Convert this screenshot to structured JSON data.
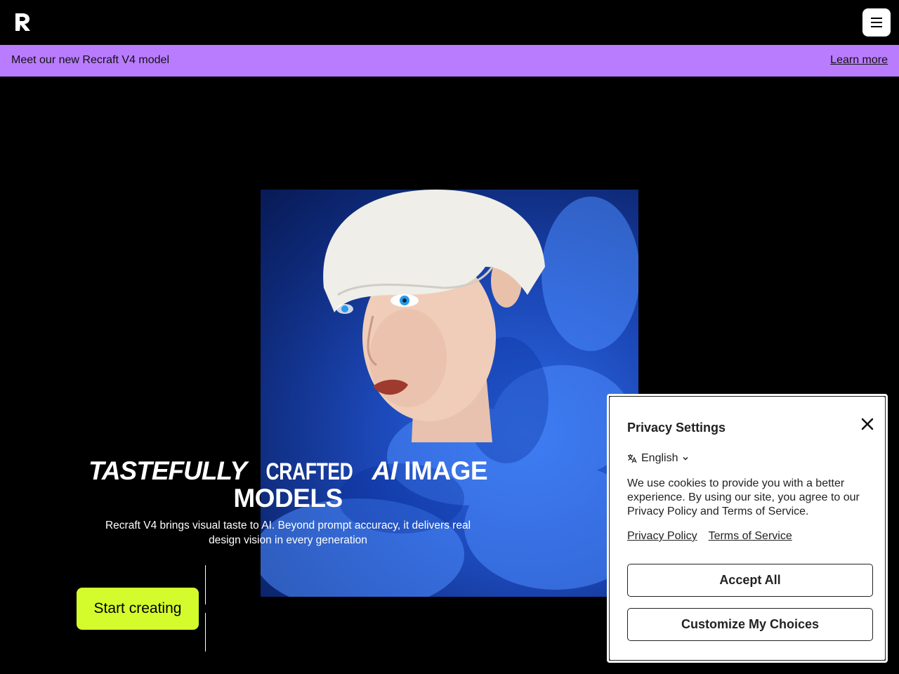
{
  "header": {
    "logo_icon": "recraft-logo-icon",
    "menu_icon": "hamburger-menu-icon"
  },
  "banner": {
    "text": "Meet our new Recraft V4 model",
    "link": "Learn more",
    "color": "#b97cff"
  },
  "hero": {
    "headline_word1": "TASTEFULLY",
    "headline_word2": "CRAFTED",
    "headline_word3": "AI",
    "headline_word4": "IMAGE",
    "headline_word5": "MODELS",
    "subheadline": "Recraft V4 brings visual taste to AI. Beyond prompt accuracy, it delivers real design vision in every generation",
    "cta": "Start creating",
    "cta_color": "#d4fc2c"
  },
  "privacy": {
    "title": "Privacy Settings",
    "language": "English",
    "body": "We use cookies to provide you with a better experience. By using our site, you agree to our Privacy Policy and Terms of Service.",
    "link_privacy": "Privacy Policy",
    "link_terms": "Terms of Service",
    "accept_all": "Accept All",
    "customize": "Customize My Choices"
  }
}
